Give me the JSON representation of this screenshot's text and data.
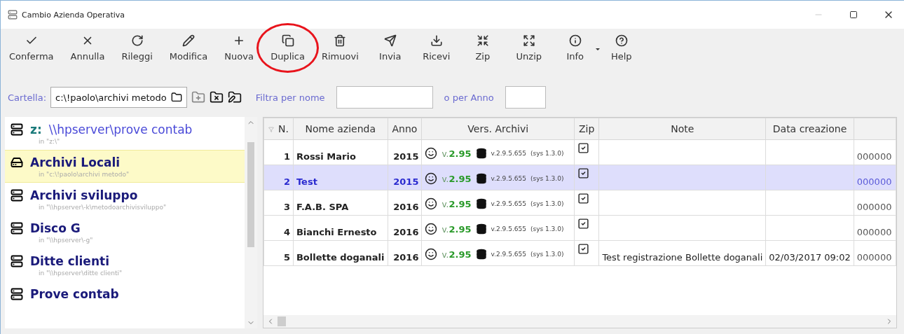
{
  "window": {
    "title": "Cambio Azienda Operativa"
  },
  "toolbar": [
    {
      "label": "Conferma",
      "highlighted": false
    },
    {
      "label": "Annulla",
      "highlighted": false
    },
    {
      "label": "Rileggi",
      "highlighted": false
    },
    {
      "label": "Modifica",
      "highlighted": false
    },
    {
      "label": "Nuova",
      "highlighted": false
    },
    {
      "label": "Duplica",
      "highlighted": true
    },
    {
      "label": "Rimuovi",
      "highlighted": false
    },
    {
      "label": "Invia",
      "highlighted": false
    },
    {
      "label": "Ricevi",
      "highlighted": false
    },
    {
      "label": "Zip",
      "highlighted": false
    },
    {
      "label": "Unzip",
      "highlighted": false
    },
    {
      "label": "Info",
      "highlighted": false
    },
    {
      "label": "Help",
      "highlighted": false
    }
  ],
  "folder_bar": {
    "label": "Cartella:",
    "value": "c:\\!paolo\\archivi metodo",
    "name_filter_label": "Filtra per nome",
    "year_filter_label": "o per Anno"
  },
  "sidebar": {
    "items": [
      {
        "drive": "z:",
        "name": "\\\\hpserver\\prove contab",
        "path": "in \"z:\\\"",
        "kind": "server",
        "selected": false
      },
      {
        "name": "Archivi Locali",
        "path": "in \"c:\\!paolo\\archivi metodo\"",
        "kind": "disk",
        "selected": true
      },
      {
        "name": "Archivi sviluppo",
        "path": "in \"\\\\hpserver\\-k\\metodoarchivisviluppo\"",
        "kind": "server",
        "selected": false
      },
      {
        "name": "Disco G",
        "path": "in \"\\\\hpserver\\-g\"",
        "kind": "server",
        "selected": false
      },
      {
        "name": "Ditte clienti",
        "path": "in \"\\\\hpserver\\ditte clienti\"",
        "kind": "server",
        "selected": false
      },
      {
        "name": "Prove contab",
        "kind": "server",
        "selected": false
      }
    ]
  },
  "table": {
    "columns": [
      "N.",
      "Nome azienda",
      "Anno",
      "Vers. Archivi",
      "Zip",
      "Note",
      "Data creazione"
    ],
    "rows": [
      {
        "n": "1",
        "name": "Rossi Mario",
        "year": "2015",
        "ver_prefix": "v.",
        "ver": "2.95",
        "db_ver": "v.2.9.5.655",
        "sys": "(sys 1.3.0)",
        "zip": true,
        "note": "",
        "date": "",
        "column_8": "000000",
        "selected": false
      },
      {
        "n": "2",
        "name": "Test",
        "year": "2015",
        "ver_prefix": "v.",
        "ver": "2.95",
        "db_ver": "v.2.9.5.655",
        "sys": "(sys 1.3.0)",
        "zip": true,
        "note": "",
        "date": "",
        "column_8": "000000",
        "selected": true
      },
      {
        "n": "3",
        "name": "F.A.B. SPA",
        "year": "2016",
        "ver_prefix": "v.",
        "ver": "2.95",
        "db_ver": "v.2.9.5.655",
        "sys": "(sys 1.3.0)",
        "zip": true,
        "note": "",
        "date": "",
        "column_8": "000000",
        "selected": false
      },
      {
        "n": "4",
        "name": "Bianchi Ernesto",
        "year": "2016",
        "ver_prefix": "v.",
        "ver": "2.95",
        "db_ver": "v.2.9.5.655",
        "sys": "(sys 1.3.0)",
        "zip": true,
        "note": "",
        "date": "",
        "column_8": "000000",
        "selected": false
      },
      {
        "n": "5",
        "name": "Bollette doganali",
        "year": "2016",
        "ver_prefix": "v.",
        "ver": "2.95",
        "db_ver": "v.2.9.5.655",
        "sys": "(sys 1.3.0)",
        "zip": true,
        "note": "Test registrazione Bollette doganali",
        "date": "02/03/2017 09:02",
        "column_8": "000000",
        "selected": false
      }
    ]
  }
}
